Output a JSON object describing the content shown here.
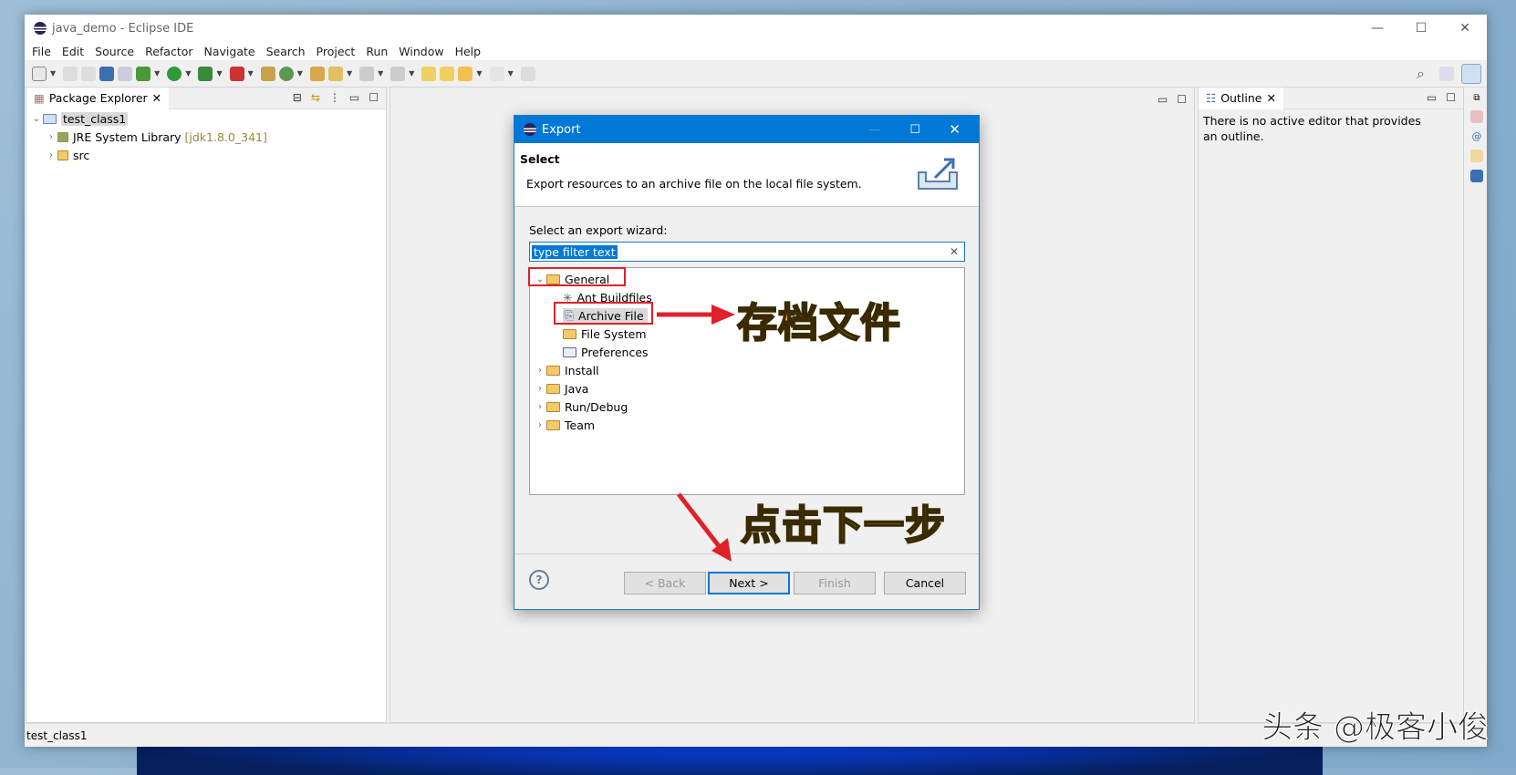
{
  "window": {
    "title": "java_demo - Eclipse IDE",
    "controls": [
      "—",
      "☐",
      "✕"
    ]
  },
  "menu": [
    "File",
    "Edit",
    "Source",
    "Refactor",
    "Navigate",
    "Search",
    "Project",
    "Run",
    "Window",
    "Help"
  ],
  "package_explorer": {
    "tab": "Package Explorer",
    "project": "test_class1",
    "items": [
      {
        "label": "JRE System Library",
        "decor": "[jdk1.8.0_341]"
      },
      {
        "label": "src",
        "decor": ""
      }
    ]
  },
  "outline": {
    "tab": "Outline",
    "message": "There is no active editor that provides an outline."
  },
  "status": "test_class1",
  "dialog": {
    "title": "Export",
    "heading": "Select",
    "description": "Export resources to an archive file on the local file system.",
    "wizard_label": "Select an export wizard:",
    "filter_value": "type filter text",
    "tree": {
      "general": "General",
      "general_children": [
        "Ant Buildfiles",
        "Archive File",
        "File System",
        "Preferences"
      ],
      "others": [
        "Install",
        "Java",
        "Run/Debug",
        "Team"
      ]
    },
    "buttons": {
      "back": "< Back",
      "next": "Next >",
      "finish": "Finish",
      "cancel": "Cancel"
    }
  },
  "annotations": {
    "archive": "存档文件",
    "next": "点击下一步",
    "watermark": "头条 @极客小俊"
  },
  "colors": {
    "accent": "#0078d7",
    "annotation_red": "#e0202a",
    "annotation_yellow": "#f6c417"
  }
}
